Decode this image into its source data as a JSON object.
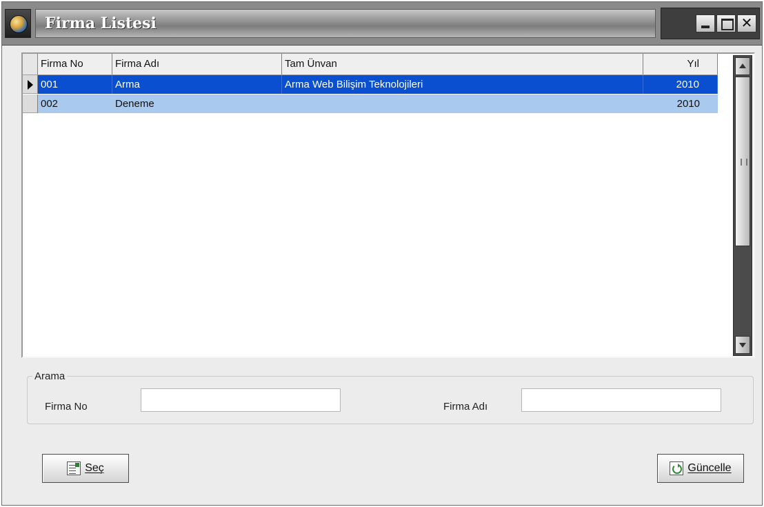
{
  "window": {
    "title": "Firma Listesi",
    "icons": {
      "app": "globe-icon",
      "minimize": "minimize-icon",
      "maximize": "maximize-icon",
      "close": "close-icon"
    },
    "close_glyph": "✕"
  },
  "grid": {
    "columns": [
      "Firma No",
      "Firma Adı",
      "Tam Ünvan",
      "Yıl"
    ],
    "rows": [
      {
        "no": "001",
        "ad": "Arma",
        "unvan": "Arma Web Bilişim Teknolojileri",
        "yil": "2010",
        "selected": true
      },
      {
        "no": "002",
        "ad": "Deneme",
        "unvan": "",
        "yil": "2010",
        "selected": false
      }
    ],
    "colors": {
      "selected_row": "#0a4fcf",
      "alt_row": "#a9c9ee"
    }
  },
  "search": {
    "legend": "Arama",
    "firma_no_label": "Firma No",
    "firma_no_value": "",
    "firma_adi_label": "Firma Adı",
    "firma_adi_value": ""
  },
  "buttons": {
    "sec_label": "Seç",
    "sec_icon": "select-list-icon",
    "guncelle_label": "Güncelle",
    "guncelle_icon": "refresh-icon"
  }
}
